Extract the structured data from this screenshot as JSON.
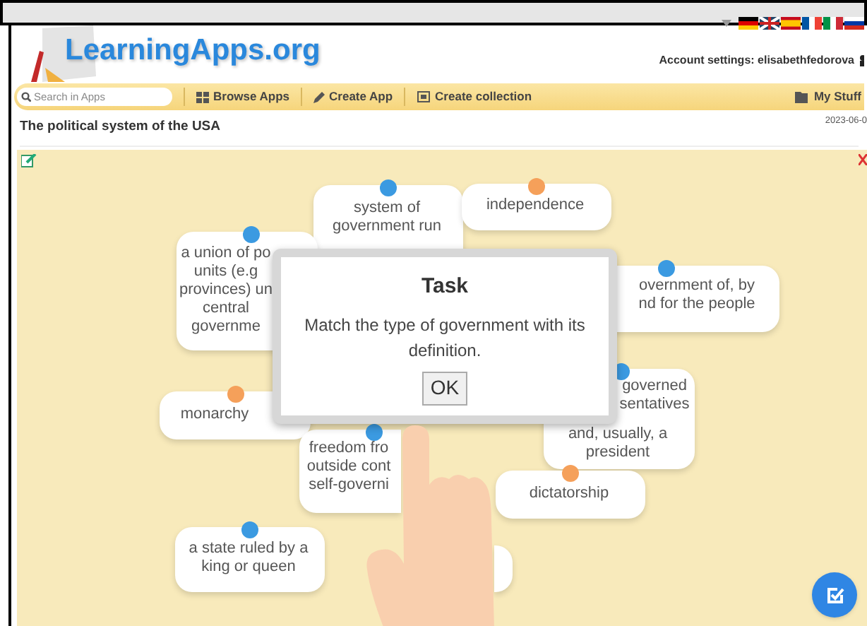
{
  "header": {
    "logo_text": "LearningApps.org",
    "account": "Account settings: elisabethfedorova"
  },
  "toolbar": {
    "search": {
      "placeholder": "Search in Apps"
    },
    "items": [
      {
        "label": "Browse Apps",
        "kind": "grid"
      },
      {
        "label": "Create App",
        "kind": "pencil"
      },
      {
        "label": "Create collection",
        "kind": "collection"
      }
    ],
    "my_stuff": "My Stuff"
  },
  "app": {
    "title": "The political system of the USA",
    "date": "2023-06-0"
  },
  "board": {
    "cards": [
      {
        "kind": "text",
        "lines": [
          "system of",
          "government run"
        ],
        "color": "#3b9ae1"
      },
      {
        "kind": "text",
        "lines": [
          "independence"
        ],
        "color": "#f5a05a"
      },
      {
        "kind": "text",
        "lines": [
          "a union of po",
          "units (e.g",
          "provinces) un",
          "central",
          "governme"
        ],
        "color": "#3b9ae1"
      },
      {
        "kind": "text",
        "lines": [
          "overnment of, by",
          "nd for the people"
        ],
        "color": "#3b9ae1"
      },
      {
        "kind": "text",
        "lines": [
          "monarchy"
        ],
        "color": "#f5a05a"
      },
      {
        "kind": "text",
        "lines": [
          "governed",
          "sentatives",
          "and, usually, a",
          "president"
        ],
        "color": "#3b9ae1"
      },
      {
        "kind": "text",
        "lines": [
          "freedom fro",
          "outside cont",
          "self-governi"
        ],
        "color": "#3b9ae1"
      },
      {
        "kind": "text",
        "lines": [
          "dictatorship"
        ],
        "color": "#f5a05a"
      },
      {
        "kind": "text",
        "lines": [
          "a state ruled by a",
          "king or queen"
        ],
        "color": "#3b9ae1"
      },
      {
        "kind": "blank"
      }
    ]
  },
  "dialog": {
    "title": "Task",
    "message": "Match the type of government with its definition.",
    "button": "OK"
  }
}
